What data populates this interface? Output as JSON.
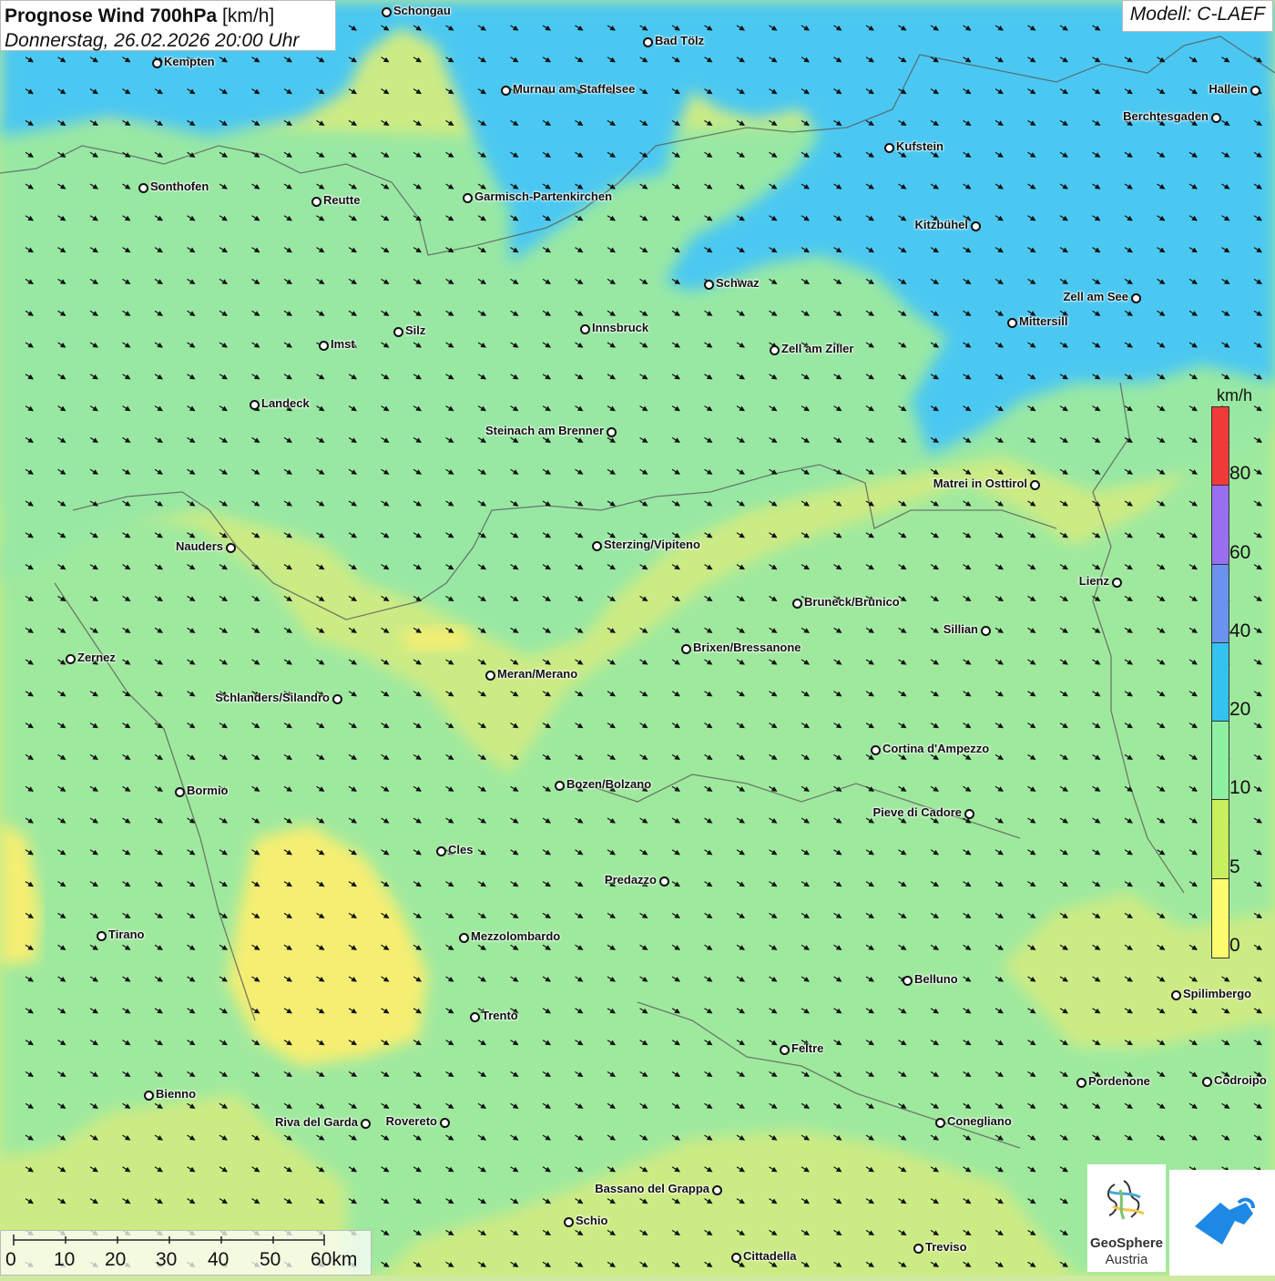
{
  "header": {
    "title_bold": "Prognose Wind 700hPa",
    "title_unit": "[km/h]",
    "subtitle": "Donnerstag, 26.02.2026 20:00 Uhr"
  },
  "model": {
    "label": "Modell: C-LAEF"
  },
  "legend": {
    "unit": "km/h",
    "bins": [
      {
        "label": "0",
        "color": "#fcfc6e"
      },
      {
        "label": "5",
        "color": "#c8ef5e"
      },
      {
        "label": "10",
        "color": "#8fefa0"
      },
      {
        "label": "20",
        "color": "#34c2f0"
      },
      {
        "label": "40",
        "color": "#6a93ef"
      },
      {
        "label": "60",
        "color": "#9a6ef0"
      },
      {
        "label": "80",
        "color": "#f03a3a"
      }
    ]
  },
  "scale": {
    "labels": [
      "0",
      "10",
      "20",
      "30",
      "40",
      "50",
      "60km"
    ]
  },
  "logos": {
    "geosphere_line1": "GeoSphere",
    "geosphere_line2": "Austria"
  },
  "wind": {
    "direction": "from northwest (arrows pointing south-east)",
    "uniform": true
  },
  "cities": [
    {
      "name": "Schongau"
    },
    {
      "name": "Bad Tölz"
    },
    {
      "name": "Kempten"
    },
    {
      "name": "Murnau am Staffelsee"
    },
    {
      "name": "Hallein"
    },
    {
      "name": "Berchtesgaden"
    },
    {
      "name": "Kufstein"
    },
    {
      "name": "Sonthofen"
    },
    {
      "name": "Reutte"
    },
    {
      "name": "Garmisch-Partenkirchen"
    },
    {
      "name": "Kitzbühel"
    },
    {
      "name": "Schwaz"
    },
    {
      "name": "Zell am See"
    },
    {
      "name": "Mittersill"
    },
    {
      "name": "Silz"
    },
    {
      "name": "Innsbruck"
    },
    {
      "name": "Imst"
    },
    {
      "name": "Zell am Ziller"
    },
    {
      "name": "Landeck"
    },
    {
      "name": "Steinach am Brenner"
    },
    {
      "name": "Matrei in Osttirol"
    },
    {
      "name": "Nauders"
    },
    {
      "name": "Sterzing/Vipiteno"
    },
    {
      "name": "Lienz"
    },
    {
      "name": "Bruneck/Brunico"
    },
    {
      "name": "Sillian"
    },
    {
      "name": "Zernez"
    },
    {
      "name": "Brixen/Bressanone"
    },
    {
      "name": "Meran/Merano"
    },
    {
      "name": "Schlanders/Silandro"
    },
    {
      "name": "Cortina d'Ampezzo"
    },
    {
      "name": "Bozen/Bolzano"
    },
    {
      "name": "Bormio"
    },
    {
      "name": "Pieve di Cadore"
    },
    {
      "name": "Cles"
    },
    {
      "name": "Predazzo"
    },
    {
      "name": "Tirano"
    },
    {
      "name": "Mezzolombardo"
    },
    {
      "name": "Belluno"
    },
    {
      "name": "Spilimbergo"
    },
    {
      "name": "Trento"
    },
    {
      "name": "Feltre"
    },
    {
      "name": "Bienno"
    },
    {
      "name": "Pordenone"
    },
    {
      "name": "Codroipo"
    },
    {
      "name": "Riva del Garda"
    },
    {
      "name": "Rovereto"
    },
    {
      "name": "Conegliano"
    },
    {
      "name": "Bassano del Grappa"
    },
    {
      "name": "Schio"
    },
    {
      "name": "Treviso"
    },
    {
      "name": "Cittadella"
    }
  ]
}
